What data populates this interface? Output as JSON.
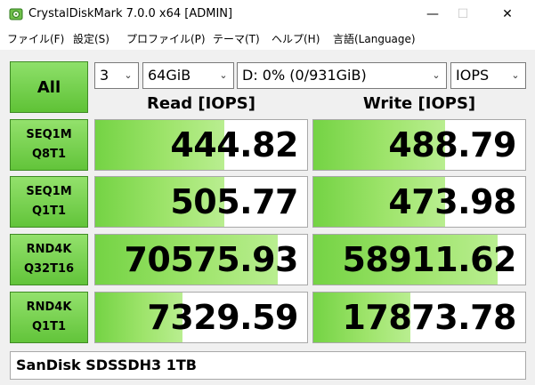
{
  "window": {
    "title": "CrystalDiskMark 7.0.0 x64 [ADMIN]",
    "controls": {
      "minimize": "—",
      "maximize": "☐",
      "close": "✕"
    }
  },
  "menu": [
    "ファイル(F)",
    "設定(S)",
    "プロファイル(P)",
    "テーマ(T)",
    "ヘルプ(H)",
    "言語(Language)"
  ],
  "toolbar": {
    "all_label": "All",
    "count": "3",
    "size": "64GiB",
    "drive": "D: 0% (0/931GiB)",
    "unit": "IOPS"
  },
  "headers": {
    "read": "Read [IOPS]",
    "write": "Write [IOPS]"
  },
  "rows": [
    {
      "line1": "SEQ1M",
      "line2": "Q8T1",
      "read": "444.82",
      "write": "488.79",
      "read_fill": 0.61,
      "write_fill": 0.62
    },
    {
      "line1": "SEQ1M",
      "line2": "Q1T1",
      "read": "505.77",
      "write": "473.98",
      "read_fill": 0.61,
      "write_fill": 0.62
    },
    {
      "line1": "RND4K",
      "line2": "Q32T16",
      "read": "70575.93",
      "write": "58911.62",
      "read_fill": 0.86,
      "write_fill": 0.87
    },
    {
      "line1": "RND4K",
      "line2": "Q1T1",
      "read": "7329.59",
      "write": "17873.78",
      "read_fill": 0.41,
      "write_fill": 0.46
    }
  ],
  "comment": "SanDisk SDSSDH3 1TB",
  "colors": {
    "accent_green": "#62c43a",
    "meter_green": "#9ee46b"
  }
}
